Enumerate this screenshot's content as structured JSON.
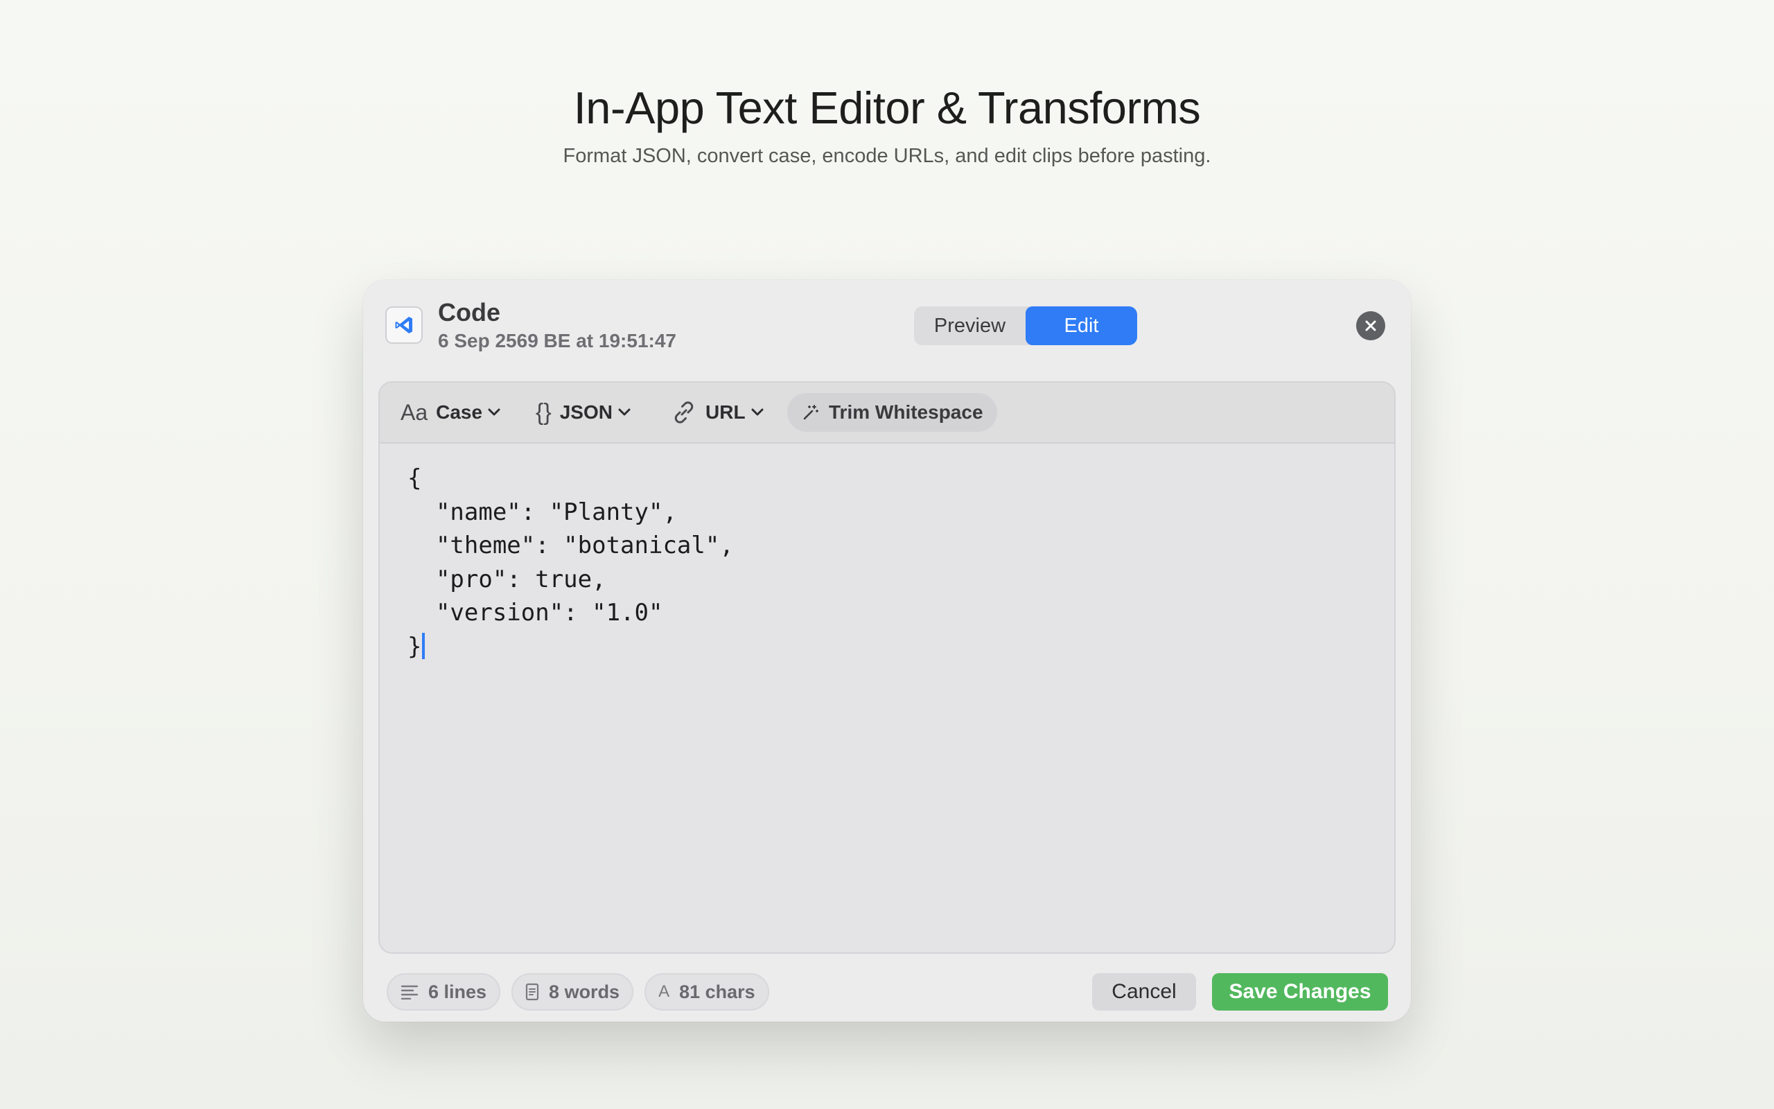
{
  "hero": {
    "title": "In-App Text Editor & Transforms",
    "subtitle": "Format JSON, convert case, encode URLs, and edit clips before pasting."
  },
  "dialog": {
    "clip_kind": "Code",
    "timestamp": "6 Sep 2569 BE at 19:51:47",
    "app_icon": "vscode-icon",
    "mode_toggle": {
      "options": [
        "Preview",
        "Edit"
      ],
      "selected": "Edit"
    },
    "close_icon": "close-icon"
  },
  "toolbar": {
    "case": {
      "glyph": "Aa",
      "label": "Case"
    },
    "json": {
      "glyph": "{}",
      "label": "JSON"
    },
    "url": {
      "glyph": "link-icon",
      "label": "URL"
    },
    "trim": {
      "glyph": "magic-wand-icon",
      "label": "Trim Whitespace"
    }
  },
  "editor": {
    "lines": [
      "{",
      "  \"name\": \"Planty\",",
      "  \"theme\": \"botanical\",",
      "  \"pro\": true,",
      "  \"version\": \"1.0\"",
      "}"
    ]
  },
  "footer": {
    "lines_count": "6 lines",
    "words_count": "8 words",
    "chars_count": "81 chars",
    "char_glyph": "A",
    "cancel_label": "Cancel",
    "save_label": "Save Changes"
  },
  "colors": {
    "accent_blue": "#2f7cf6",
    "save_green": "#52b85e",
    "close_gray": "#5f6064"
  }
}
